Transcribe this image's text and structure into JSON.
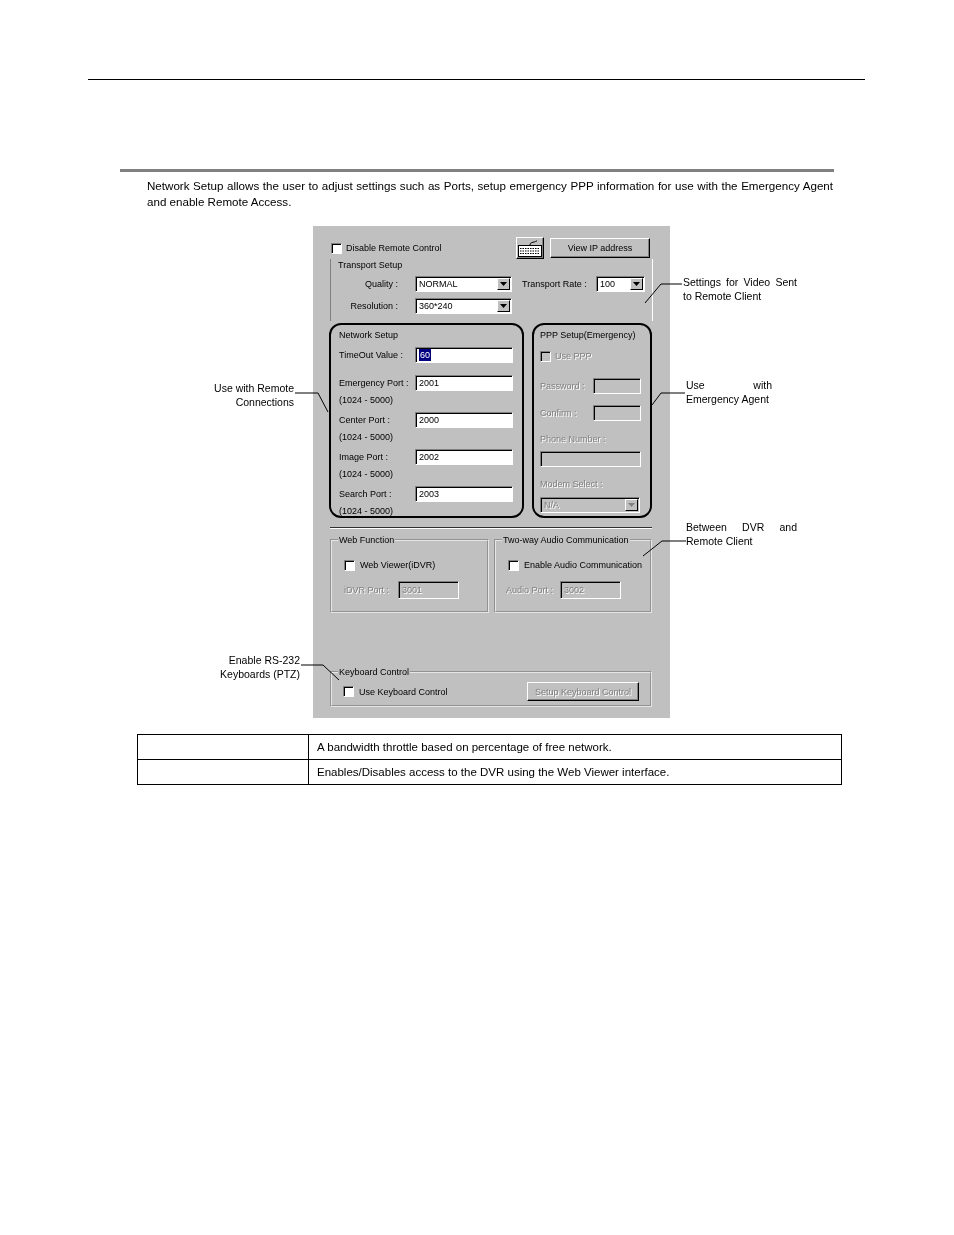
{
  "intro": "Network Setup allows the user to adjust settings such as Ports, setup emergency PPP information for use with the Emergency Agent and enable Remote Access.",
  "dialog": {
    "disable_remote_control": {
      "label": "Disable Remote Control",
      "checked": false
    },
    "view_ip_button": {
      "label": "View IP address"
    },
    "transport_setup": {
      "title": "Transport Setup",
      "quality": {
        "label": "Quality :",
        "value": "NORMAL"
      },
      "resolution": {
        "label": "Resolution :",
        "value": "360*240"
      },
      "transport_rate": {
        "label": "Transport Rate :",
        "value": "100"
      },
      "callout": "Settings for Video Sent to Remote Client"
    },
    "network_setup": {
      "title": "Network Setup",
      "callout": "Use with Remote Connections",
      "fields": [
        {
          "label": "TimeOut Value :",
          "value": "60",
          "text_selected": true
        },
        {
          "label": "Emergency Port :",
          "range": "(1024 - 5000)",
          "value": "2001",
          "text_selected": false
        },
        {
          "label": "Center Port :",
          "range": "(1024 - 5000)",
          "value": "2000",
          "text_selected": false
        },
        {
          "label": "Image Port :",
          "range": "(1024 - 5000)",
          "value": "2002",
          "text_selected": false
        },
        {
          "label": "Search Port :",
          "range": "(1024 - 5000)",
          "value": "2003",
          "text_selected": false
        }
      ]
    },
    "ppp_setup": {
      "title": "PPP Setup(Emergency)",
      "disabled": true,
      "use_ppp": {
        "label": "Use PPP",
        "checked": false
      },
      "password": {
        "label": "Password :"
      },
      "confirm": {
        "label": "Confirm :"
      },
      "phone_number": {
        "label": "Phone Number :"
      },
      "modem_select": {
        "label": "Modem Select :",
        "value": "N/A"
      },
      "callout": "Use with Emergency Agent"
    },
    "web_function": {
      "title": "Web Function",
      "checkbox": {
        "label": "Web Viewer(iDVR)",
        "checked": false
      },
      "port": {
        "label": "iDVR Port :",
        "value": "3001",
        "disabled": true
      }
    },
    "audio": {
      "title": "Two-way Audio Communication",
      "checkbox": {
        "label": "Enable Audio Communication",
        "checked": false
      },
      "port": {
        "label": "Audio Port :",
        "value": "3002",
        "disabled": true
      },
      "callout": "Between DVR and Remote Client"
    },
    "keyboard_control": {
      "title": "Keyboard Control",
      "checkbox": {
        "label": "Use Keyboard Control",
        "checked": false
      },
      "setup_button": {
        "label": "Setup Keyboard Control",
        "disabled": true
      },
      "callout": "Enable RS-232 Keyboards (PTZ)"
    }
  },
  "table": {
    "rows": [
      "A bandwidth throttle based on percentage of free network.",
      "Enables/Disables access to the DVR using the Web Viewer interface."
    ]
  }
}
